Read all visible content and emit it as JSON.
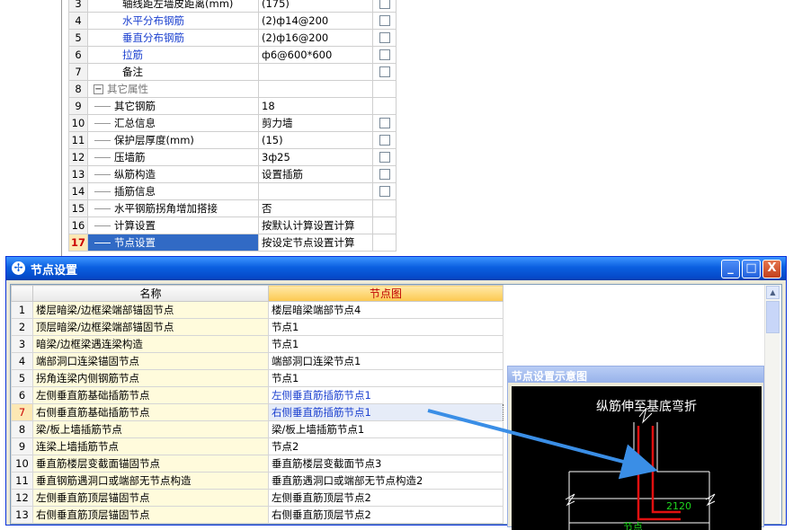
{
  "property_grid": {
    "rows": [
      {
        "num": "3",
        "name": "轴线距左墙皮距离(mm)",
        "value": "(175)",
        "style": "",
        "checkbox": true,
        "tree": false
      },
      {
        "num": "4",
        "name": "水平分布钢筋",
        "value": "(2)ф14@200",
        "style": "blue",
        "checkbox": true,
        "tree": false
      },
      {
        "num": "5",
        "name": "垂直分布钢筋",
        "value": "(2)ф16@200",
        "style": "blue",
        "checkbox": true,
        "tree": false
      },
      {
        "num": "6",
        "name": "拉筋",
        "value": "ф6@600*600",
        "style": "blue",
        "checkbox": true,
        "tree": false
      },
      {
        "num": "7",
        "name": "备注",
        "value": "",
        "style": "",
        "checkbox": true,
        "tree": false
      },
      {
        "num": "8",
        "name": "其它属性",
        "value": "",
        "style": "gray",
        "checkbox": false,
        "tree": false,
        "toggle": "−"
      },
      {
        "num": "9",
        "name": "其它钢筋",
        "value": "18",
        "style": "",
        "checkbox": false,
        "tree": true
      },
      {
        "num": "10",
        "name": "汇总信息",
        "value": "剪力墙",
        "style": "",
        "checkbox": true,
        "tree": true
      },
      {
        "num": "11",
        "name": "保护层厚度(mm)",
        "value": "(15)",
        "style": "",
        "checkbox": true,
        "tree": true
      },
      {
        "num": "12",
        "name": "压墙筋",
        "value": "3ф25",
        "style": "",
        "checkbox": true,
        "tree": true
      },
      {
        "num": "13",
        "name": "纵筋构造",
        "value": "设置插筋",
        "style": "",
        "checkbox": true,
        "tree": true
      },
      {
        "num": "14",
        "name": "插筋信息",
        "value": "",
        "style": "",
        "checkbox": true,
        "tree": true
      },
      {
        "num": "15",
        "name": "水平钢筋拐角增加搭接",
        "value": "否",
        "style": "",
        "checkbox": false,
        "tree": true
      },
      {
        "num": "16",
        "name": "计算设置",
        "value": "按默认计算设置计算",
        "style": "",
        "checkbox": false,
        "tree": true
      },
      {
        "num": "17",
        "name": "节点设置",
        "value": "按设定节点设置计算",
        "style": "",
        "checkbox": false,
        "tree": true,
        "selected": true
      }
    ]
  },
  "dialog": {
    "title": "节点设置",
    "icon": "app-icon",
    "buttons": {
      "minimize": "_",
      "maximize": "□",
      "close": "X"
    },
    "table": {
      "headers": {
        "name": "名称",
        "node": "节点图"
      },
      "rows": [
        {
          "idx": "1",
          "name": "楼层暗梁/边框梁端部锚固节点",
          "node": "楼层暗梁端部节点4",
          "style": ""
        },
        {
          "idx": "2",
          "name": "顶层暗梁/边框梁端部锚固节点",
          "node": "节点1",
          "style": ""
        },
        {
          "idx": "3",
          "name": "暗梁/边框梁遇连梁构造",
          "node": "节点1",
          "style": ""
        },
        {
          "idx": "4",
          "name": "端部洞口连梁锚固节点",
          "node": "端部洞口连梁节点1",
          "style": ""
        },
        {
          "idx": "5",
          "name": "拐角连梁内侧钢筋节点",
          "node": "节点1",
          "style": ""
        },
        {
          "idx": "6",
          "name": "左侧垂直筋基础插筋节点",
          "node": "左侧垂直筋插筋节点1",
          "style": "blue"
        },
        {
          "idx": "7",
          "name": "右侧垂直筋基础插筋节点",
          "node": "右侧垂直筋插筋节点1",
          "style": "blue",
          "selected": true
        },
        {
          "idx": "8",
          "name": "梁/板上墙插筋节点",
          "node": "梁/板上墙插筋节点1",
          "style": ""
        },
        {
          "idx": "9",
          "name": "连梁上墙插筋节点",
          "node": "节点2",
          "style": ""
        },
        {
          "idx": "10",
          "name": "垂直筋楼层变截面锚固节点",
          "node": "垂直筋楼层变截面节点3",
          "style": ""
        },
        {
          "idx": "11",
          "name": "垂直钢筋遇洞口或端部无节点构造",
          "node": "垂直筋遇洞口或端部无节点构造2",
          "style": ""
        },
        {
          "idx": "12",
          "name": "左侧垂直筋顶层锚固节点",
          "node": "左侧垂直筋顶层节点2",
          "style": ""
        },
        {
          "idx": "13",
          "name": "右侧垂直筋顶层锚固节点",
          "node": "右侧垂直筋顶层节点2",
          "style": ""
        }
      ]
    },
    "preview": {
      "title": "节点设置示意图",
      "annotation": "纵筋伸至基底弯折",
      "dimension": "2120",
      "caption": "节点"
    }
  },
  "colors": {
    "title_bar": "#0a5fe0",
    "selection": "#316ac5",
    "link_blue": "#1a3fcf",
    "rebar_red": "#e01010",
    "dimension_green": "#1fd61f",
    "arrow_blue": "#3a8ee6"
  }
}
